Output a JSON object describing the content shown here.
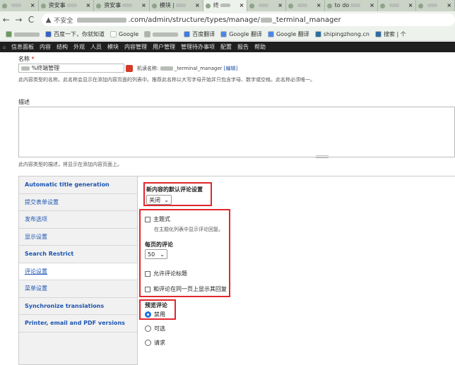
{
  "browser": {
    "tabs": [
      {
        "label": "",
        "active": false
      },
      {
        "label": "资安事",
        "active": false
      },
      {
        "label": "资安事",
        "active": false
      },
      {
        "label": "模块 |",
        "active": false
      },
      {
        "label": "终",
        "active": true
      },
      {
        "label": "",
        "active": false
      },
      {
        "label": "",
        "active": false
      },
      {
        "label": "to do",
        "active": false
      },
      {
        "label": "",
        "active": false
      },
      {
        "label": "",
        "active": false
      }
    ],
    "tab_close": "×",
    "nav": {
      "back": "←",
      "forward": "→",
      "reload": "C"
    },
    "security_text": "不安全",
    "url_prefix": ".com/admin/structure/types/manage/",
    "url_suffix": "_terminal_manager",
    "bookmarks": [
      {
        "label": "",
        "color": "#6a9b5a"
      },
      {
        "label": "百度一下，你就知道",
        "color": "#3562c7"
      },
      {
        "label": "Google",
        "color": "#ffffff"
      },
      {
        "label": "",
        "color": "#aab6a6"
      },
      {
        "label": "百度翻译",
        "color": "#3d7be8"
      },
      {
        "label": "Google 翻译",
        "color": "#4a88e8"
      },
      {
        "label": "Google 翻译",
        "color": "#4a88e8"
      },
      {
        "label": "shipingzhong.cn",
        "color": "#2c6ea3"
      },
      {
        "label": "搜索 | 个",
        "color": "#2c6ea3"
      }
    ]
  },
  "admin_menu": [
    "信息面板",
    "内容",
    "结构",
    "外观",
    "人员",
    "模块",
    "内容管理",
    "用户管理",
    "管理待办事项",
    "配置",
    "报告",
    "帮助"
  ],
  "form": {
    "name_label": "名称",
    "required_mark": "*",
    "name_value": "%终端管理",
    "machine_name_label": "机读名称:",
    "machine_name_value": "_terminal_manager",
    "machine_edit": "[编辑]",
    "name_help": "此内容类型的名称。此名称会显示在添加内容页面的列表中。推荐此名称以大写字母开始并只包含字母、数字或空格。此名称必须唯一。",
    "desc_label": "描述",
    "desc_help": "此内容类型的描述，将显示在添加内容页面上。"
  },
  "vertical_tabs": [
    {
      "label": "Automatic title generation",
      "selected": false
    },
    {
      "label": "提交表单设置",
      "selected": false
    },
    {
      "label": "发布选项",
      "selected": false
    },
    {
      "label": "显示设置",
      "selected": false
    },
    {
      "label": "Search Restrict",
      "selected": false
    },
    {
      "label": "评论设置",
      "selected": true
    },
    {
      "label": "菜单设置",
      "selected": false
    },
    {
      "label": "Synchronize translations",
      "selected": false
    },
    {
      "label": "Printer, email and PDF versions",
      "selected": false
    }
  ],
  "comment_settings": {
    "default_label": "新内容的默认评论设置",
    "default_value": "关闭",
    "threaded_label": "主题式",
    "threaded_desc": "在主题化列表中显示评论回复。",
    "per_page_label": "每页的评论",
    "per_page_value": "50",
    "allow_title_label": "允许评论标题",
    "separate_page_label": "和评论在同一页上显示其回复",
    "preview_label": "预览评论",
    "preview_options": [
      {
        "label": "禁用",
        "checked": true
      },
      {
        "label": "可选",
        "checked": false
      },
      {
        "label": "请求",
        "checked": false
      }
    ]
  },
  "colors": {
    "highlight": "#e0282e",
    "link": "#1d55b0",
    "admin_bar": "#1f1f1f"
  }
}
